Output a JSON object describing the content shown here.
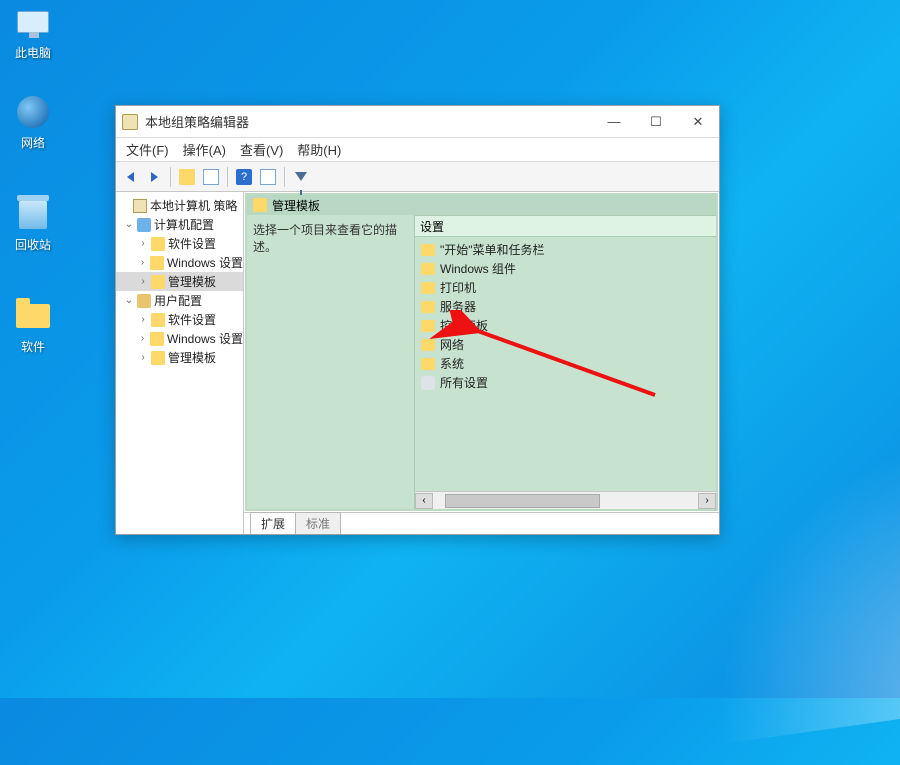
{
  "desktop": {
    "icons": [
      {
        "label": "此电脑"
      },
      {
        "label": "网络"
      },
      {
        "label": "回收站"
      },
      {
        "label": "软件"
      }
    ]
  },
  "window": {
    "title": "本地组策略编辑器",
    "menu": {
      "file": "文件(F)",
      "action": "操作(A)",
      "view": "查看(V)",
      "help": "帮助(H)"
    },
    "tree": {
      "root": "本地计算机 策略",
      "computer_config": "计算机配置",
      "user_config": "用户配置",
      "software_settings": "软件设置",
      "windows_settings": "Windows 设置",
      "admin_templates": "管理模板"
    },
    "content": {
      "header": "管理模板",
      "description": "选择一个项目来查看它的描述。",
      "settings_column": "设置",
      "items": {
        "start_menu": "\"开始\"菜单和任务栏",
        "windows_components": "Windows 组件",
        "printers": "打印机",
        "server": "服务器",
        "control_panel": "控制面板",
        "network": "网络",
        "system": "系统",
        "all_settings": "所有设置"
      }
    },
    "tabs": {
      "extended": "扩展",
      "standard": "标准"
    }
  }
}
